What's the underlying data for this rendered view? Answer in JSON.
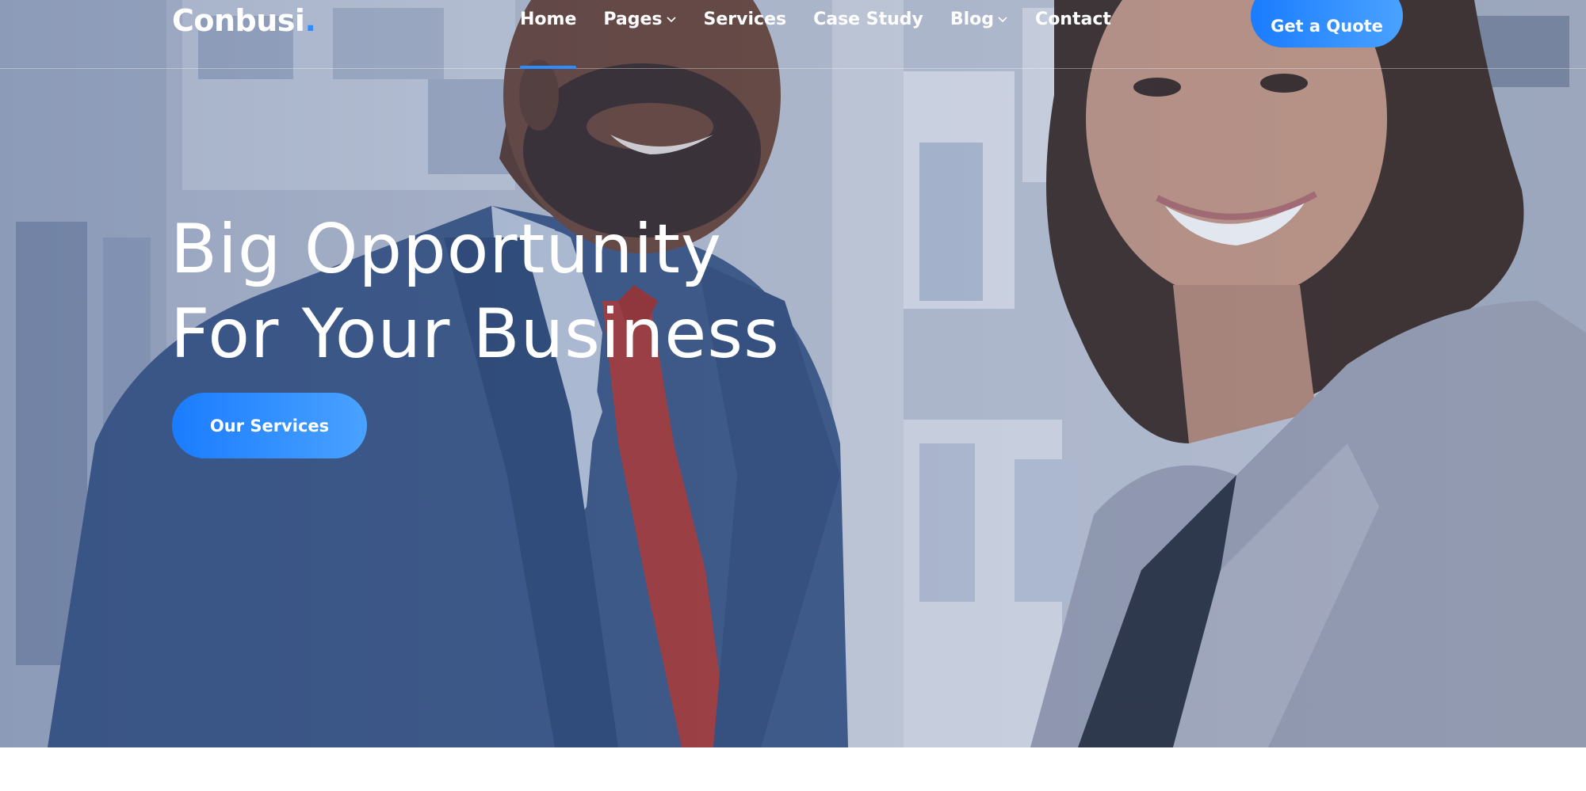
{
  "brand": {
    "name": "Conbusi",
    "dot": ".",
    "accent_color": "#2d8cff"
  },
  "nav": {
    "items": [
      {
        "label": "Home",
        "active": true,
        "dropdown": false
      },
      {
        "label": "Pages",
        "active": false,
        "dropdown": true
      },
      {
        "label": "Services",
        "active": false,
        "dropdown": false
      },
      {
        "label": "Case Study",
        "active": false,
        "dropdown": false
      },
      {
        "label": "Blog",
        "active": false,
        "dropdown": true
      },
      {
        "label": "Contact",
        "active": false,
        "dropdown": false
      }
    ],
    "cta_label": "Get a Quote"
  },
  "hero": {
    "title_line1": "Big Opportunity",
    "title_line2": "For Your Business",
    "button_label": "Our Services",
    "image_icon": "business-people-photo"
  }
}
